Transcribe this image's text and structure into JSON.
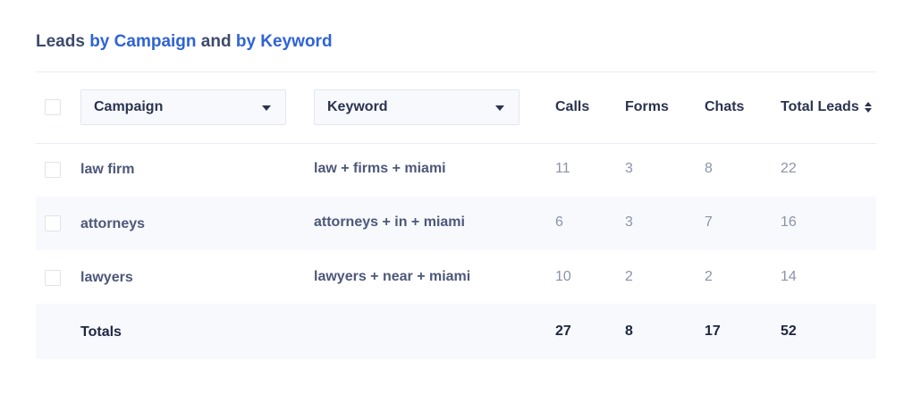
{
  "title": {
    "part1": "Leads",
    "part2": "by Campaign",
    "part3": "and",
    "part4": "by Keyword"
  },
  "header": {
    "campaign_dropdown": "Campaign",
    "keyword_dropdown": "Keyword",
    "calls": "Calls",
    "forms": "Forms",
    "chats": "Chats",
    "total_leads": "Total Leads"
  },
  "rows": [
    {
      "campaign": "law firm",
      "keyword": "law + firms + miami",
      "calls": "11",
      "forms": "3",
      "chats": "8",
      "total": "22"
    },
    {
      "campaign": "attorneys",
      "keyword": "attorneys + in + miami",
      "calls": "6",
      "forms": "3",
      "chats": "7",
      "total": "16"
    },
    {
      "campaign": "lawyers",
      "keyword": "lawyers + near + miami",
      "calls": "10",
      "forms": "2",
      "chats": "2",
      "total": "14"
    }
  ],
  "totals": {
    "label": "Totals",
    "calls": "27",
    "forms": "8",
    "chats": "17",
    "total": "52"
  },
  "colors": {
    "link": "#2f63d6",
    "text": "#2b3350",
    "alt_row": "#f8f9fc"
  }
}
